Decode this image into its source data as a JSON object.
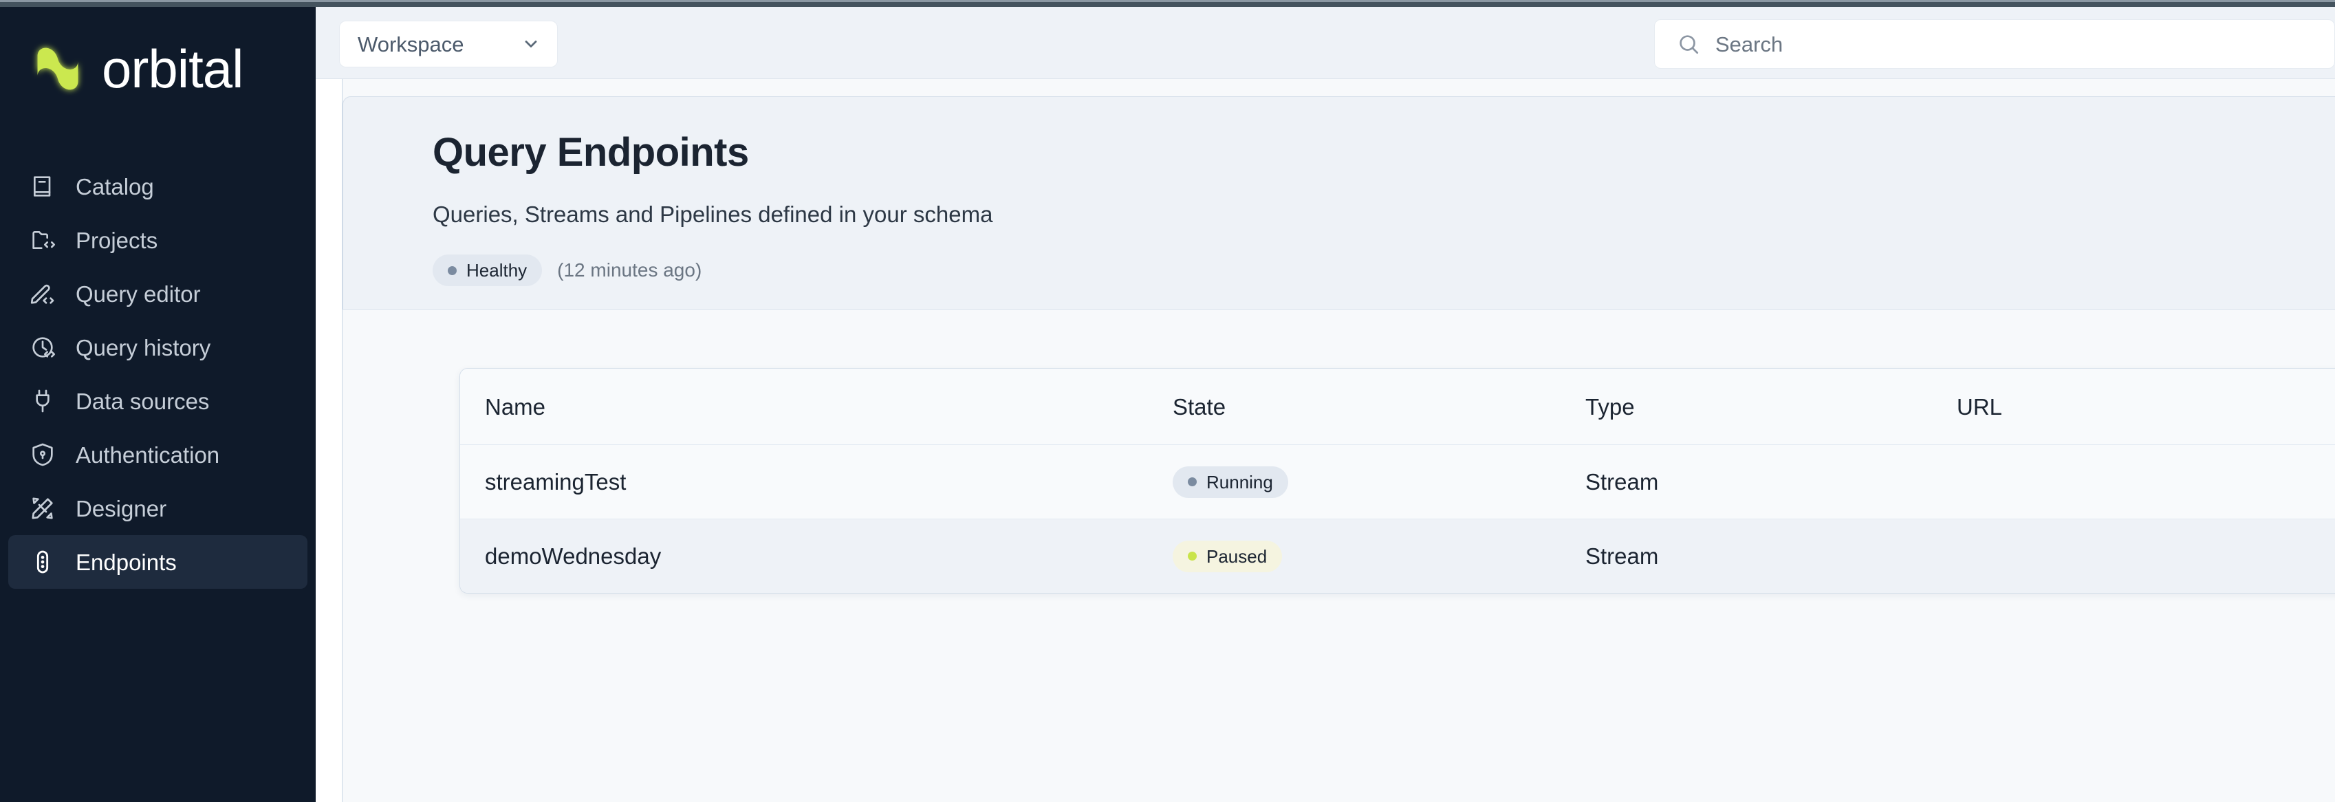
{
  "brand": {
    "name": "orbital",
    "logo_icon": "orbital-logo-mark",
    "accent": "#cbe84f"
  },
  "sidebar": {
    "items": [
      {
        "label": "Catalog",
        "icon": "book-icon",
        "active": false
      },
      {
        "label": "Projects",
        "icon": "folder-code-icon",
        "active": false
      },
      {
        "label": "Query editor",
        "icon": "pencil-code-icon",
        "active": false
      },
      {
        "label": "Query history",
        "icon": "clock-code-icon",
        "active": false
      },
      {
        "label": "Data sources",
        "icon": "plug-icon",
        "active": false
      },
      {
        "label": "Authentication",
        "icon": "shield-lock-icon",
        "active": false
      },
      {
        "label": "Designer",
        "icon": "pen-ruler-icon",
        "active": false
      },
      {
        "label": "Endpoints",
        "icon": "traffic-light-icon",
        "active": true
      }
    ]
  },
  "topbar": {
    "workspace": {
      "label": "Workspace",
      "icon": "chevron-down-icon"
    },
    "search": {
      "placeholder": "Search",
      "icon": "search-icon"
    }
  },
  "page": {
    "title": "Query Endpoints",
    "subtitle": "Queries, Streams and Pipelines defined in your schema",
    "status": {
      "label": "Healthy",
      "dot_color": "#7b8ba0",
      "timestamp": "(12 minutes ago)"
    }
  },
  "table": {
    "columns": [
      "Name",
      "State",
      "Type",
      "URL"
    ],
    "rows": [
      {
        "name": "streamingTest",
        "state": "Running",
        "state_dot": "#7b8ba0",
        "state_style": "running",
        "type": "Stream",
        "url": ""
      },
      {
        "name": "demoWednesday",
        "state": "Paused",
        "state_dot": "#c9e44a",
        "state_style": "paused",
        "type": "Stream",
        "url": ""
      }
    ]
  }
}
